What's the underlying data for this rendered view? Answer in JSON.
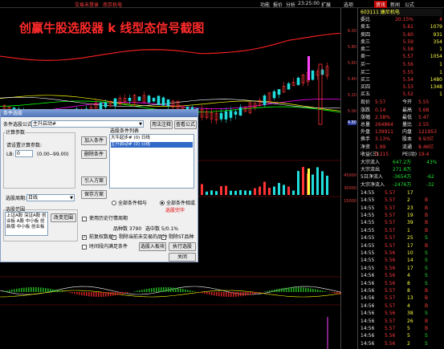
{
  "topbar": {
    "links": [
      "交易未登录",
      "南京机电"
    ],
    "time": "23:25:00",
    "menus": [
      "功能",
      "报价",
      "分析",
      "扩展",
      "选项",
      "资讯",
      "新闻",
      "公式"
    ],
    "active_menu": "资讯"
  },
  "chart": {
    "banner": "创赢牛股选股器 k 线型态信号截图",
    "axis_ticks": [
      "6.00",
      "5.80",
      "5.60",
      "5.40",
      "5.20",
      "5.00",
      "4.80",
      "4.60"
    ],
    "volume_ticks": [
      "45000",
      "30000",
      "15000"
    ],
    "colors": {
      "up": "#ff3333",
      "down": "#22dddd",
      "ma1": "#ffffff",
      "ma2": "#ffff00",
      "ma3": "#ff00ff",
      "ma4": "#00ff00",
      "ma5": "#ff2020"
    }
  },
  "quote": {
    "header": "603111 康尼机电",
    "weibi": {
      "label": "委比",
      "value": "20.15%",
      "label2": "委差",
      "value2": "4"
    },
    "sell": [
      {
        "label": "卖五",
        "price": "5.61",
        "vol": "1079"
      },
      {
        "label": "卖四",
        "price": "5.60",
        "vol": "931"
      },
      {
        "label": "卖三",
        "price": "5.59",
        "vol": "354"
      },
      {
        "label": "卖二",
        "price": "5.58",
        "vol": "1"
      },
      {
        "label": "卖一",
        "price": "5.57",
        "vol": "1054"
      }
    ],
    "buy": [
      {
        "label": "买一",
        "price": "5.56",
        "vol": "1"
      },
      {
        "label": "买二",
        "price": "5.55",
        "vol": "1"
      },
      {
        "label": "买三",
        "price": "5.54",
        "vol": "1480"
      },
      {
        "label": "买四",
        "price": "5.53",
        "vol": "1348"
      },
      {
        "label": "买五",
        "price": "5.52",
        "vol": "1"
      }
    ],
    "stats": [
      {
        "l1": "现价",
        "v1": "5.57",
        "l2": "今开",
        "v2": "5.55"
      },
      {
        "l1": "涨跌",
        "v1": "0.14",
        "l2": "最高",
        "v2": "5.68"
      },
      {
        "l1": "涨幅",
        "v1": "2.58%",
        "l2": "最低",
        "v2": "5.47"
      },
      {
        "l1": "总量",
        "v1": "264864",
        "l2": "量比",
        "v2": "2.55"
      },
      {
        "l1": "外盘",
        "v1": "139911",
        "l2": "内盘",
        "v2": "121953"
      },
      {
        "l1": "换手",
        "v1": "3.13%",
        "l2": "股本",
        "v2": "9.93亿"
      },
      {
        "l1": "净资",
        "v1": "1.99",
        "l2": "流通",
        "v2": "8.46亿"
      },
      {
        "l1": "收益(三)",
        "v1": "0.215",
        "l2": "PE(动)",
        "v2": "19.4"
      }
    ],
    "flows": [
      {
        "label": "大宗流入",
        "v1": "647.2万",
        "v2": "43%"
      },
      {
        "label": "大宗流出",
        "v1": "271.8万",
        "v2": ""
      },
      {
        "label": "5日净流入",
        "v1": "-3654万",
        "v2": "-62"
      },
      {
        "label": "大宗净流入",
        "v1": "-2476万",
        "v2": "-32"
      }
    ],
    "ticks": [
      {
        "t": "14:55",
        "p": "5.57",
        "v": "17",
        "s": ""
      },
      {
        "t": "14:55",
        "p": "5.57",
        "v": "2",
        "s": "B"
      },
      {
        "t": "14:55",
        "p": "5.57",
        "v": "23",
        "s": "B"
      },
      {
        "t": "14:55",
        "p": "5.57",
        "v": "19",
        "s": "B"
      },
      {
        "t": "14:55",
        "p": "5.57",
        "v": "39",
        "s": "B"
      },
      {
        "t": "14:55",
        "p": "5.57",
        "v": "1",
        "s": "B"
      },
      {
        "t": "14:55",
        "p": "5.57",
        "v": "25",
        "s": "S"
      },
      {
        "t": "14:55",
        "p": "5.57",
        "v": "17",
        "s": "B"
      },
      {
        "t": "14:55",
        "p": "5.56",
        "v": "10",
        "s": "S"
      },
      {
        "t": "14:55",
        "p": "5.56",
        "v": "14",
        "s": "S"
      },
      {
        "t": "14:55",
        "p": "5.56",
        "v": "17",
        "s": "S"
      },
      {
        "t": "14:56",
        "p": "5.56",
        "v": "4",
        "s": "S"
      },
      {
        "t": "14:56",
        "p": "5.56",
        "v": "8",
        "s": "S"
      },
      {
        "t": "14:56",
        "p": "5.57",
        "v": "8",
        "s": "B"
      },
      {
        "t": "14:56",
        "p": "5.57",
        "v": "13",
        "s": "B"
      },
      {
        "t": "14:56",
        "p": "5.57",
        "v": "4",
        "s": "B"
      },
      {
        "t": "14:56",
        "p": "5.56",
        "v": "38",
        "s": "S"
      },
      {
        "t": "14:56",
        "p": "5.57",
        "v": "26",
        "s": "B"
      },
      {
        "t": "14:56",
        "p": "5.57",
        "v": "5",
        "s": "B"
      },
      {
        "t": "14:56",
        "p": "5.56",
        "v": "5",
        "s": "S"
      },
      {
        "t": "14:56",
        "p": "5.56",
        "v": "2",
        "s": "S"
      },
      {
        "t": "14:56",
        "p": "5.57",
        "v": "6",
        "s": "B"
      },
      {
        "t": "14:56",
        "p": "5.57",
        "v": "57",
        "s": "B"
      },
      {
        "t": "14:56",
        "p": "5.56",
        "v": "2",
        "s": "S"
      },
      {
        "t": "14:56",
        "p": "5.57",
        "v": "1",
        "s": "B"
      },
      {
        "t": "15:00",
        "p": "5.57",
        "v": "39",
        "s": "B"
      }
    ]
  },
  "dialog": {
    "title": "条件选股",
    "formula_label": "条件选股公式",
    "formula_value": "主升启动#",
    "btn_usage": "用法注释",
    "btn_view_formula": "查看公式",
    "params_label": "计算参数",
    "param_hint": "请设置计算参数:",
    "param_name": "LB:",
    "param_value": "0",
    "param_range": "(0.00--99.00)",
    "btn_add": "加入条件",
    "btn_delete": "删除条件",
    "btn_import": "引入方案",
    "btn_save": "保存方案",
    "list_label": "选股条件列表",
    "conditions": [
      "大牛起步# (0) 日线",
      "主升启动# (0) 日线"
    ],
    "period_label": "选股周期:",
    "period_value": "日线",
    "and_option": "全部条件相与",
    "or_option": "全部条件相或",
    "selected_done": "选股完毕",
    "range_label": "选股范围",
    "range_text": "上证A股 深证A股 创业板 A股 中小板 创新版 中小板 创业板",
    "btn_change_range": "改变范围",
    "use_history": "使用历史行情周期",
    "count_text": "品种数 3790",
    "picked_text": "选中数 5/0.1%",
    "cb_rights": "前复权数据",
    "cb_exclude_new": "剔除当前未交易的品种",
    "cb_exclude_st": "剔除ST品种",
    "cb_time": "时间段内满足条件",
    "btn_to_block": "选股入板块",
    "btn_run": "执行选股",
    "btn_close": "关闭"
  }
}
